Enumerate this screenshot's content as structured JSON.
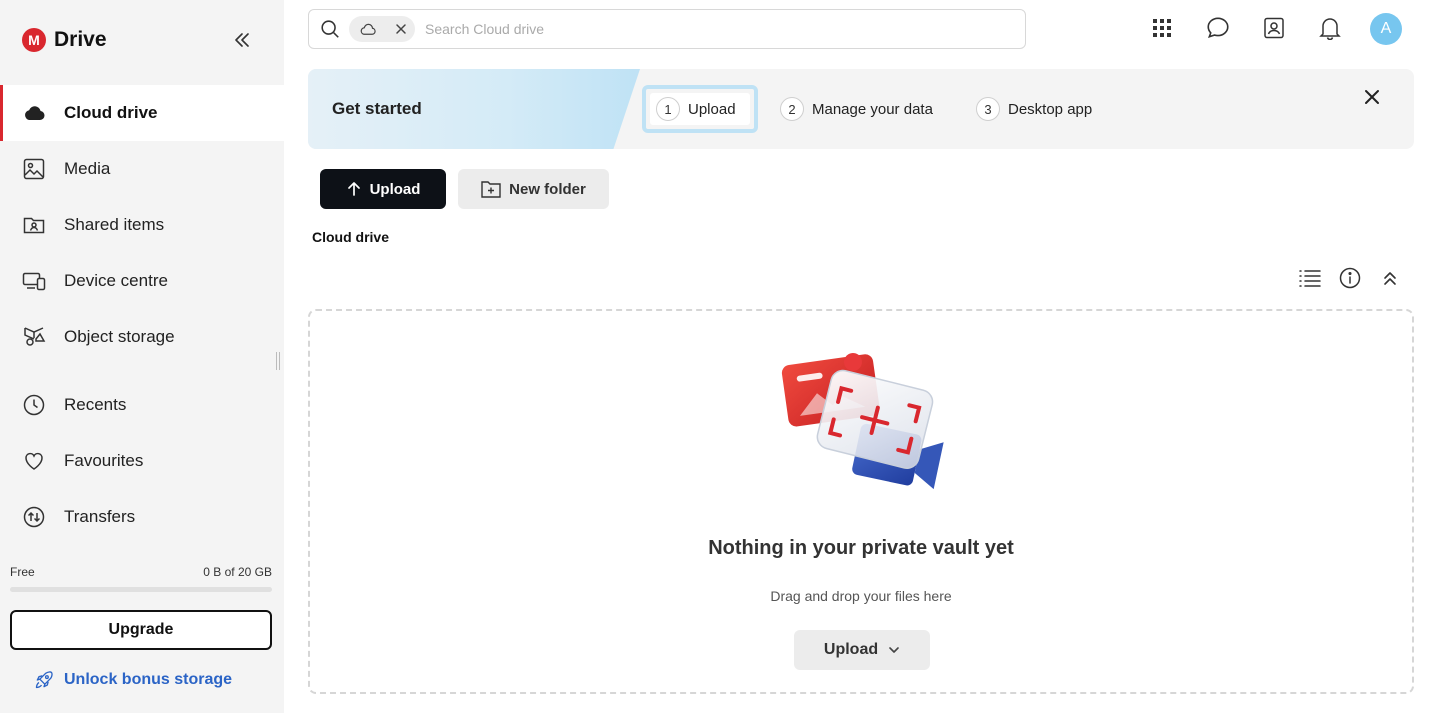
{
  "brand": {
    "name": "Drive",
    "logo_letter": "M",
    "accent_color": "#d9272e"
  },
  "sidebar": {
    "items": [
      {
        "label": "Cloud drive",
        "icon": "cloud-icon",
        "active": true
      },
      {
        "label": "Media",
        "icon": "image-icon"
      },
      {
        "label": "Shared items",
        "icon": "shared-folder-icon"
      },
      {
        "label": "Device centre",
        "icon": "devices-icon"
      },
      {
        "label": "Object storage",
        "icon": "object-storage-icon"
      },
      {
        "label": "Recents",
        "icon": "clock-icon"
      },
      {
        "label": "Favourites",
        "icon": "heart-icon"
      },
      {
        "label": "Transfers",
        "icon": "transfers-icon"
      }
    ],
    "storage": {
      "plan": "Free",
      "usage": "0 B of 20 GB",
      "used_fraction": 0
    },
    "upgrade_label": "Upgrade",
    "bonus_label": "Unlock bonus storage"
  },
  "search": {
    "placeholder": "Search Cloud drive",
    "value": ""
  },
  "topbar": {
    "avatar_letter": "A"
  },
  "banner": {
    "title": "Get started",
    "steps": [
      {
        "num": "1",
        "label": "Upload",
        "active": true
      },
      {
        "num": "2",
        "label": "Manage your data"
      },
      {
        "num": "3",
        "label": "Desktop app"
      }
    ]
  },
  "actions": {
    "upload_label": "Upload",
    "new_folder_label": "New folder"
  },
  "breadcrumb": "Cloud drive",
  "empty": {
    "title": "Nothing in your private vault yet",
    "subtitle": "Drag and drop your files here",
    "upload_label": "Upload"
  }
}
